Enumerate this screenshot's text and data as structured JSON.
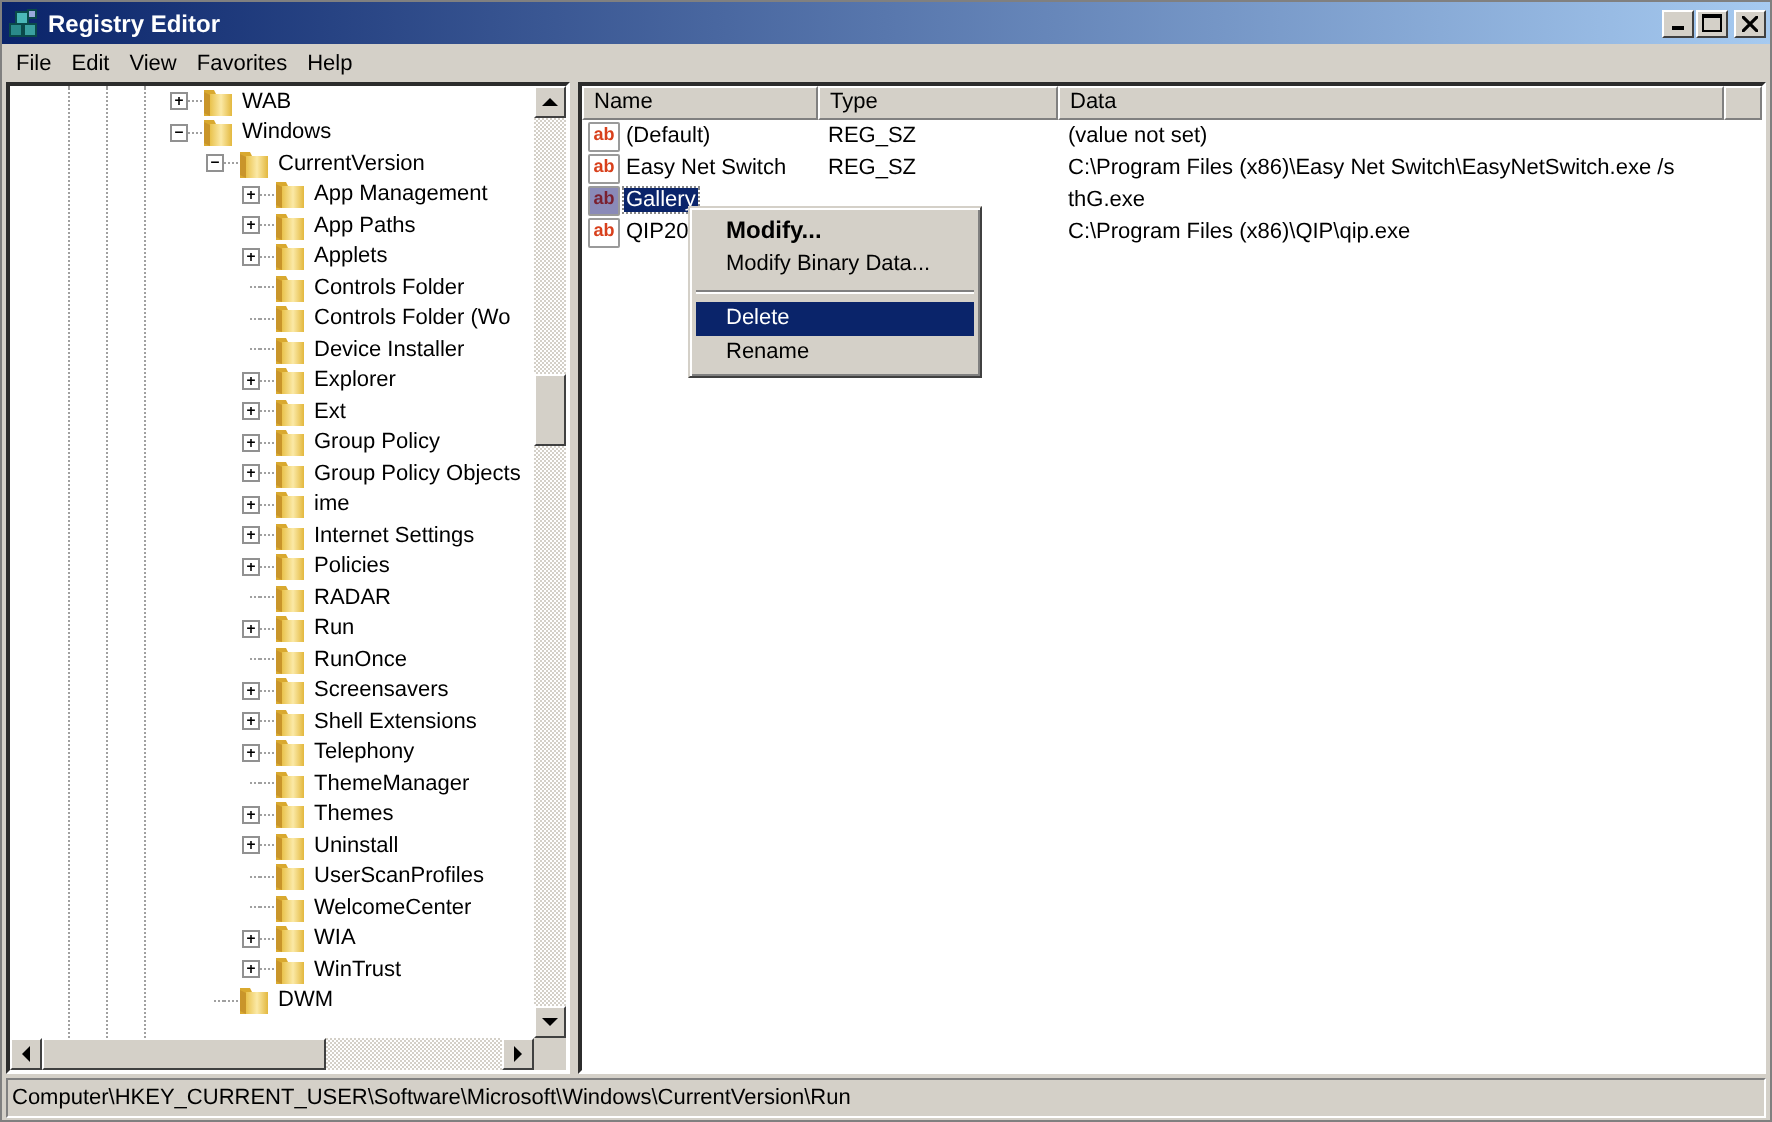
{
  "window": {
    "title": "Registry Editor"
  },
  "menu": [
    "File",
    "Edit",
    "View",
    "Favorites",
    "Help"
  ],
  "tree": [
    {
      "label": "WAB",
      "expanded": false
    },
    {
      "label": "Windows",
      "expanded": true,
      "children": [
        {
          "label": "CurrentVersion",
          "expanded": true,
          "children": [
            {
              "label": "App Management",
              "expanded": false
            },
            {
              "label": "App Paths",
              "expanded": false
            },
            {
              "label": "Applets",
              "expanded": false
            },
            {
              "label": "Controls Folder"
            },
            {
              "label": "Controls Folder (Wo"
            },
            {
              "label": "Device Installer"
            },
            {
              "label": "Explorer",
              "expanded": false
            },
            {
              "label": "Ext",
              "expanded": false
            },
            {
              "label": "Group Policy",
              "expanded": false
            },
            {
              "label": "Group Policy Objects",
              "expanded": false
            },
            {
              "label": "ime",
              "expanded": false
            },
            {
              "label": "Internet Settings",
              "expanded": false
            },
            {
              "label": "Policies",
              "expanded": false
            },
            {
              "label": "RADAR"
            },
            {
              "label": "Run",
              "expanded": false
            },
            {
              "label": "RunOnce"
            },
            {
              "label": "Screensavers",
              "expanded": false
            },
            {
              "label": "Shell Extensions",
              "expanded": false
            },
            {
              "label": "Telephony",
              "expanded": false
            },
            {
              "label": "ThemeManager"
            },
            {
              "label": "Themes",
              "expanded": false
            },
            {
              "label": "Uninstall",
              "expanded": false
            },
            {
              "label": "UserScanProfiles"
            },
            {
              "label": "WelcomeCenter"
            },
            {
              "label": "WIA",
              "expanded": false
            },
            {
              "label": "WinTrust",
              "expanded": false
            }
          ]
        },
        {
          "label": "DWM"
        }
      ]
    }
  ],
  "values": {
    "columns": [
      "Name",
      "Type",
      "Data"
    ],
    "rows": [
      {
        "icon_text": "ab",
        "name": "(Default)",
        "type": "REG_SZ",
        "data": "(value not set)",
        "selected": false
      },
      {
        "icon_text": "ab",
        "name": "Easy Net Switch",
        "type": "REG_SZ",
        "data": "C:\\Program Files (x86)\\Easy Net Switch\\EasyNetSwitch.exe /s",
        "selected": false
      },
      {
        "icon_text": "ab",
        "name": "Gallery",
        "data": "thG.exe",
        "selected": true
      },
      {
        "icon_text": "ab",
        "name": "QIP20",
        "data": "C:\\Program Files (x86)\\QIP\\qip.exe",
        "selected": false
      }
    ]
  },
  "context_menu": [
    {
      "kind": "item",
      "label": "Modify...",
      "default": true,
      "selected": false
    },
    {
      "kind": "item",
      "label": "Modify Binary Data...",
      "default": false,
      "selected": false
    },
    {
      "kind": "separator"
    },
    {
      "kind": "item",
      "label": "Delete",
      "default": false,
      "selected": true
    },
    {
      "kind": "item",
      "label": "Rename",
      "default": false,
      "selected": false
    }
  ],
  "status_bar": "Computer\\HKEY_CURRENT_USER\\Software\\Microsoft\\Windows\\CurrentVersion\\Run"
}
